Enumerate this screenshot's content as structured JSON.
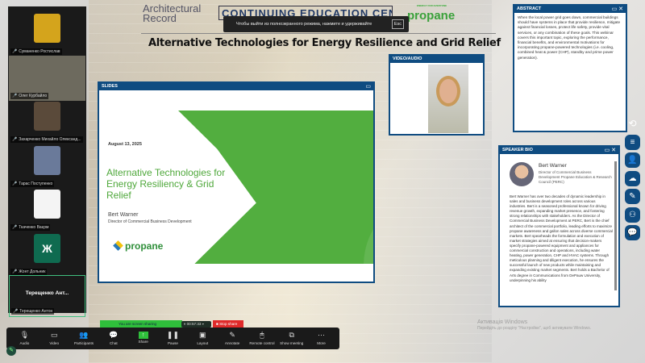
{
  "participants": [
    {
      "name": "Суманенко Ростислав",
      "color": "#d4a41c",
      "tile": "photo"
    },
    {
      "name": "Олег Курбайло",
      "color": "#7a6a5a",
      "tile": "video"
    },
    {
      "name": "Захарченко Михайло Олександ...",
      "color": "#5a4a3a",
      "tile": "photo"
    },
    {
      "name": "Тарас Поступенко",
      "color": "#6a7a9a",
      "tile": "photo"
    },
    {
      "name": "Ткаченко Ваєрм",
      "color": "#f4f4f4",
      "tile": "photo"
    },
    {
      "name": "Жонт Дольник",
      "color": "#0f6b50",
      "tile": "initial",
      "initial": "Ж"
    },
    {
      "name": "Терещенко Антон",
      "color": "#1a1a1a",
      "tile": "active",
      "display": "Терещенко Ант..."
    }
  ],
  "header": {
    "brand1_line1": "Architectural",
    "brand1_line2": "Record",
    "brand2": "CONTINUING EDUCATION CENTER",
    "sponsor": "propane",
    "sponsor_tag": "ENERGY FOR EVERYONE",
    "title": "Alternative Technologies for Energy Resilience and Grid Relief"
  },
  "toast": {
    "text": "Чтобы выйти из полноэкранного режима, нажмите и удерживайте",
    "key": "Esc"
  },
  "slides": {
    "label": "SLIDES",
    "date": "August 13, 2025",
    "title": "Alternative Technologies for Energy Resiliency & Grid Relief",
    "presenter": "Bert Warner",
    "role": "Director of Commercial Business Development",
    "logo": "propane"
  },
  "video": {
    "label": "VIDEO/AUDIO"
  },
  "abstract": {
    "label": "ABSTRACT",
    "text": "When the local power grid goes down, commercial buildings should have systems in place that provide resilience, mitigate against financial losses, protect life safety, provide vital services, or any combination of these goals. This webinar covers this important topic, exploring the performance, financial benefits, and environmental motivations for incorporating propane-powered technologies (i.e. cooling, combined heat & power (CHP), standby and prime power generation)."
  },
  "bio": {
    "label": "SPEAKER BIO",
    "name": "Bert Warner",
    "role": "Director of Commercial Business Development Propane Education & Research Council (PERC)",
    "text": "Bert Warner has over two decades of dynamic leadership in sales and business development roles across various industries. Bert is a seasoned professional known for driving revenue growth, expanding market presence, and fostering strong relationships with stakeholders. As the Director of Commercial Business Development at PERC, Bert is the chief architect of the commercial portfolio, leading efforts to maximize propane awareness and gallon sales across diverse commercial markets. Bert spearheads the formulation and execution of market strategies aimed at ensuring that decision-makers specify propane-powered equipment and appliances for commercial construction and operations, including water heating, power generation, CHP and HVAC systems. Through meticulous planning and diligent execution, he ensures the successful launch of new products while maintaining and expanding existing market segments. Bert holds a Bachelor of Arts degree in Communications from DePauw University, underpinning his ability"
  },
  "right_icons": [
    "reset-icon",
    "menu-icon",
    "user-check-icon",
    "cloud-transfer-icon",
    "survey-icon",
    "group-icon",
    "chat-icon"
  ],
  "sharing": {
    "status": "You are screen sharing",
    "timer": "00:57:33",
    "stop": "Stop share"
  },
  "toolbar": [
    {
      "label": "Audio",
      "icon": "🎙"
    },
    {
      "label": "Video",
      "icon": "▭"
    },
    {
      "label": "Participants",
      "icon": "👥"
    },
    {
      "label": "Chat",
      "icon": "💬"
    },
    {
      "label": "Share",
      "icon": "↑"
    },
    {
      "label": "Pause",
      "icon": "❚❚"
    },
    {
      "label": "Layout",
      "icon": "▣"
    },
    {
      "label": "Annotate",
      "icon": "✎"
    },
    {
      "label": "Remote control",
      "icon": "🖱"
    },
    {
      "label": "Show meeting",
      "icon": "⧉"
    },
    {
      "label": "More",
      "icon": "⋯"
    }
  ],
  "participants_count": "7",
  "windows_activation": {
    "title": "Активація Windows",
    "subtitle": "Перейдіть до розділу \"Настройки\", щоб активувати Windows."
  }
}
